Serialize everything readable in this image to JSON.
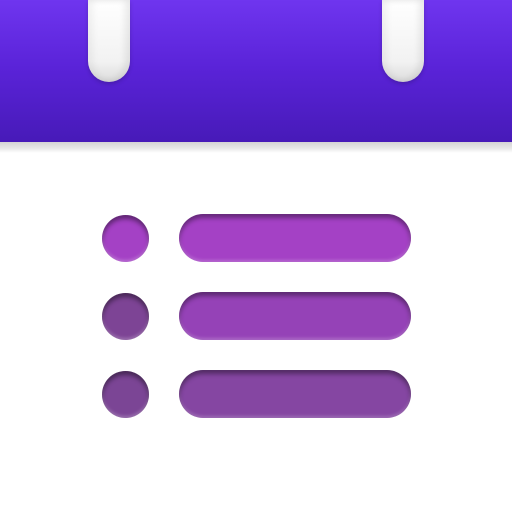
{
  "icon": {
    "name": "calendar-list-icon",
    "colors": {
      "header_gradient": [
        "#6f35ef",
        "#471ab8"
      ],
      "background": "#ffffff",
      "list_items": [
        "#a441c5",
        "#9542b7",
        "#8546a2"
      ]
    }
  },
  "list": {
    "items": [
      {
        "bullet_icon": "circle-bullet",
        "line_icon": "text-line-placeholder"
      },
      {
        "bullet_icon": "circle-bullet",
        "line_icon": "text-line-placeholder"
      },
      {
        "bullet_icon": "circle-bullet",
        "line_icon": "text-line-placeholder"
      }
    ]
  }
}
